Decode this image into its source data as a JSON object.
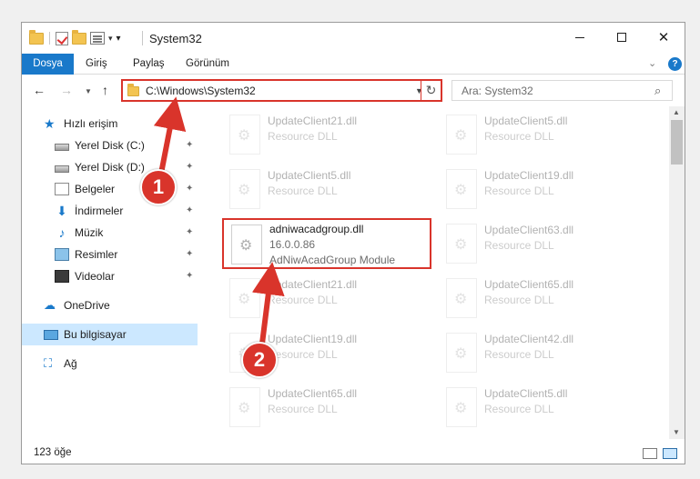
{
  "window": {
    "title": "System32"
  },
  "ribbon": {
    "tabs": [
      {
        "label": "Dosya"
      },
      {
        "label": "Giriş"
      },
      {
        "label": "Paylaş"
      },
      {
        "label": "Görünüm"
      }
    ],
    "help": "?"
  },
  "address": {
    "path": "C:\\Windows\\System32",
    "search_placeholder": "Ara: System32"
  },
  "nav": {
    "quick_access": "Hızlı erişim",
    "items": [
      {
        "label": "Yerel Disk (C:)"
      },
      {
        "label": "Yerel Disk (D:)"
      },
      {
        "label": "Belgeler"
      },
      {
        "label": "İndirmeler"
      },
      {
        "label": "Müzik"
      },
      {
        "label": "Resimler"
      },
      {
        "label": "Videolar"
      }
    ],
    "onedrive": "OneDrive",
    "this_pc": "Bu bilgisayar",
    "network": "Ağ"
  },
  "files": {
    "left": [
      {
        "name": "UpdateClient21.dll",
        "desc": "Resource DLL"
      },
      {
        "name": "UpdateClient5.dll",
        "desc": "Resource DLL"
      },
      {
        "name": "adniwacadgroup.dll",
        "version": "16.0.0.86",
        "desc": "AdNiwAcadGroup Module"
      },
      {
        "name": "UpdateClient21.dll",
        "desc": "Resource DLL"
      },
      {
        "name": "UpdateClient19.dll",
        "desc": "Resource DLL"
      },
      {
        "name": "UpdateClient65.dll",
        "desc": "Resource DLL"
      }
    ],
    "right": [
      {
        "name": "UpdateClient5.dll",
        "desc": "Resource DLL"
      },
      {
        "name": "UpdateClient19.dll",
        "desc": "Resource DLL"
      },
      {
        "name": "UpdateClient63.dll",
        "desc": "Resource DLL"
      },
      {
        "name": "UpdateClient65.dll",
        "desc": "Resource DLL"
      },
      {
        "name": "UpdateClient42.dll",
        "desc": "Resource DLL"
      },
      {
        "name": "UpdateClient5.dll",
        "desc": "Resource DLL"
      }
    ]
  },
  "status": {
    "count": "123 öğe"
  },
  "annotations": {
    "step1": "1",
    "step2": "2",
    "color": "#d9342b"
  }
}
